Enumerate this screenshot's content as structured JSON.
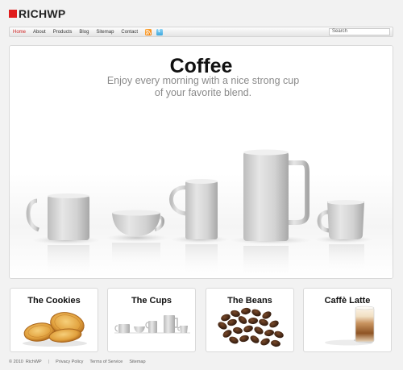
{
  "brand": {
    "name": "RICHWP",
    "accent": "#e01c1c"
  },
  "nav": {
    "items": [
      "Home",
      "About",
      "Products",
      "Blog",
      "Sitemap",
      "Contact"
    ],
    "active": "Home",
    "icons": [
      "rss-icon",
      "twitter-icon"
    ],
    "search_value": "Search"
  },
  "hero": {
    "title": "Coffee",
    "subtitle_line1": "Enjoy every morning with a nice strong cup",
    "subtitle_line2": "of your favorite blend."
  },
  "features": [
    {
      "title": "The Cookies"
    },
    {
      "title": "The Cups"
    },
    {
      "title": "The Beans"
    },
    {
      "title": "Caffè Latte"
    }
  ],
  "footer": {
    "copyright": "© 2010",
    "brand": "RichWP",
    "separator": "|",
    "links": [
      "Privacy Policy",
      "Terms of Service",
      "Sitemap"
    ]
  }
}
